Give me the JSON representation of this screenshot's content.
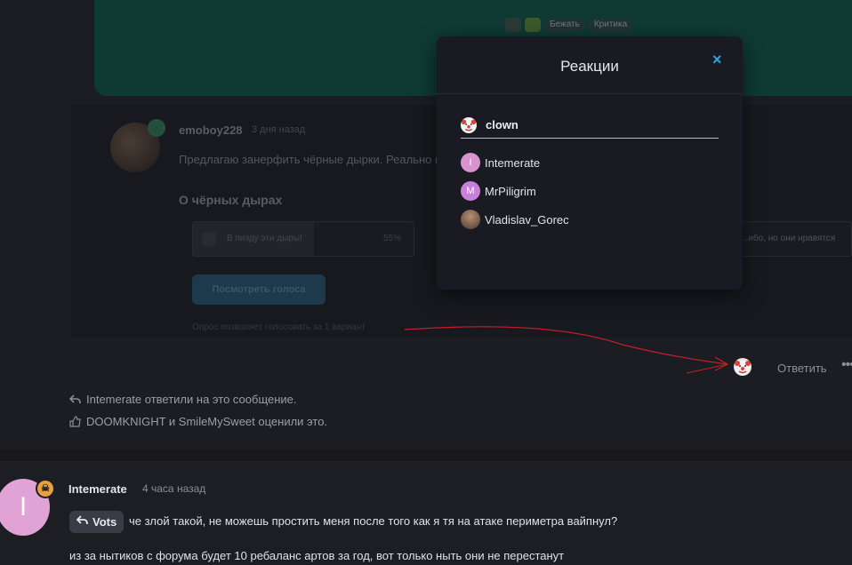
{
  "background_post": {
    "chips": [
      "Бежать",
      "Критика"
    ],
    "username": "emoboy228",
    "time": "3 дня назад",
    "text": "Предлагаю занерфить чёрные дырки. Реально на",
    "poll": {
      "title": "О чёрных дырах",
      "option1": "В пизду эти дыры!",
      "option1_percent": "55%",
      "option1_fill": 0.55,
      "option2": "...ибо, но они нравятся",
      "vote_button": "Посмотреть голоса",
      "note": "Опрос позволяет голосовать за 1 вариант"
    }
  },
  "actions": {
    "reply_label": "Ответить",
    "more_label": "•••",
    "reaction_icon": "clown-face-icon"
  },
  "meta": {
    "replied_text": "Intemerate ответили на это сообщение.",
    "liked_text": "DOOMKNIGHT и SmileMySweet оценили это."
  },
  "next_post": {
    "username": "Intemerate",
    "time": "4 часа назад",
    "avatar_letter": "I",
    "quote_label": "Vots",
    "line1": "че злой такой, не можешь простить меня после того как я тя на атаке периметра вайпнул?",
    "line2": "из за нытиков с форума будет 10 ребаланс артов за год, вот только ныть они не перестанут"
  },
  "modal": {
    "title": "Реакции",
    "close_symbol": "×",
    "tab_label": "clown",
    "users": [
      {
        "name": "Intemerate",
        "letter": "I"
      },
      {
        "name": "MrPiligrim",
        "letter": "M"
      },
      {
        "name": "Vladislav_Gorec",
        "letter": ""
      }
    ]
  },
  "colors": {
    "accent": "#2aa7e6",
    "annotation_arrow": "#c0202a",
    "avatar_pink": "#e1a2d6",
    "badge_orange": "#e9a040"
  }
}
